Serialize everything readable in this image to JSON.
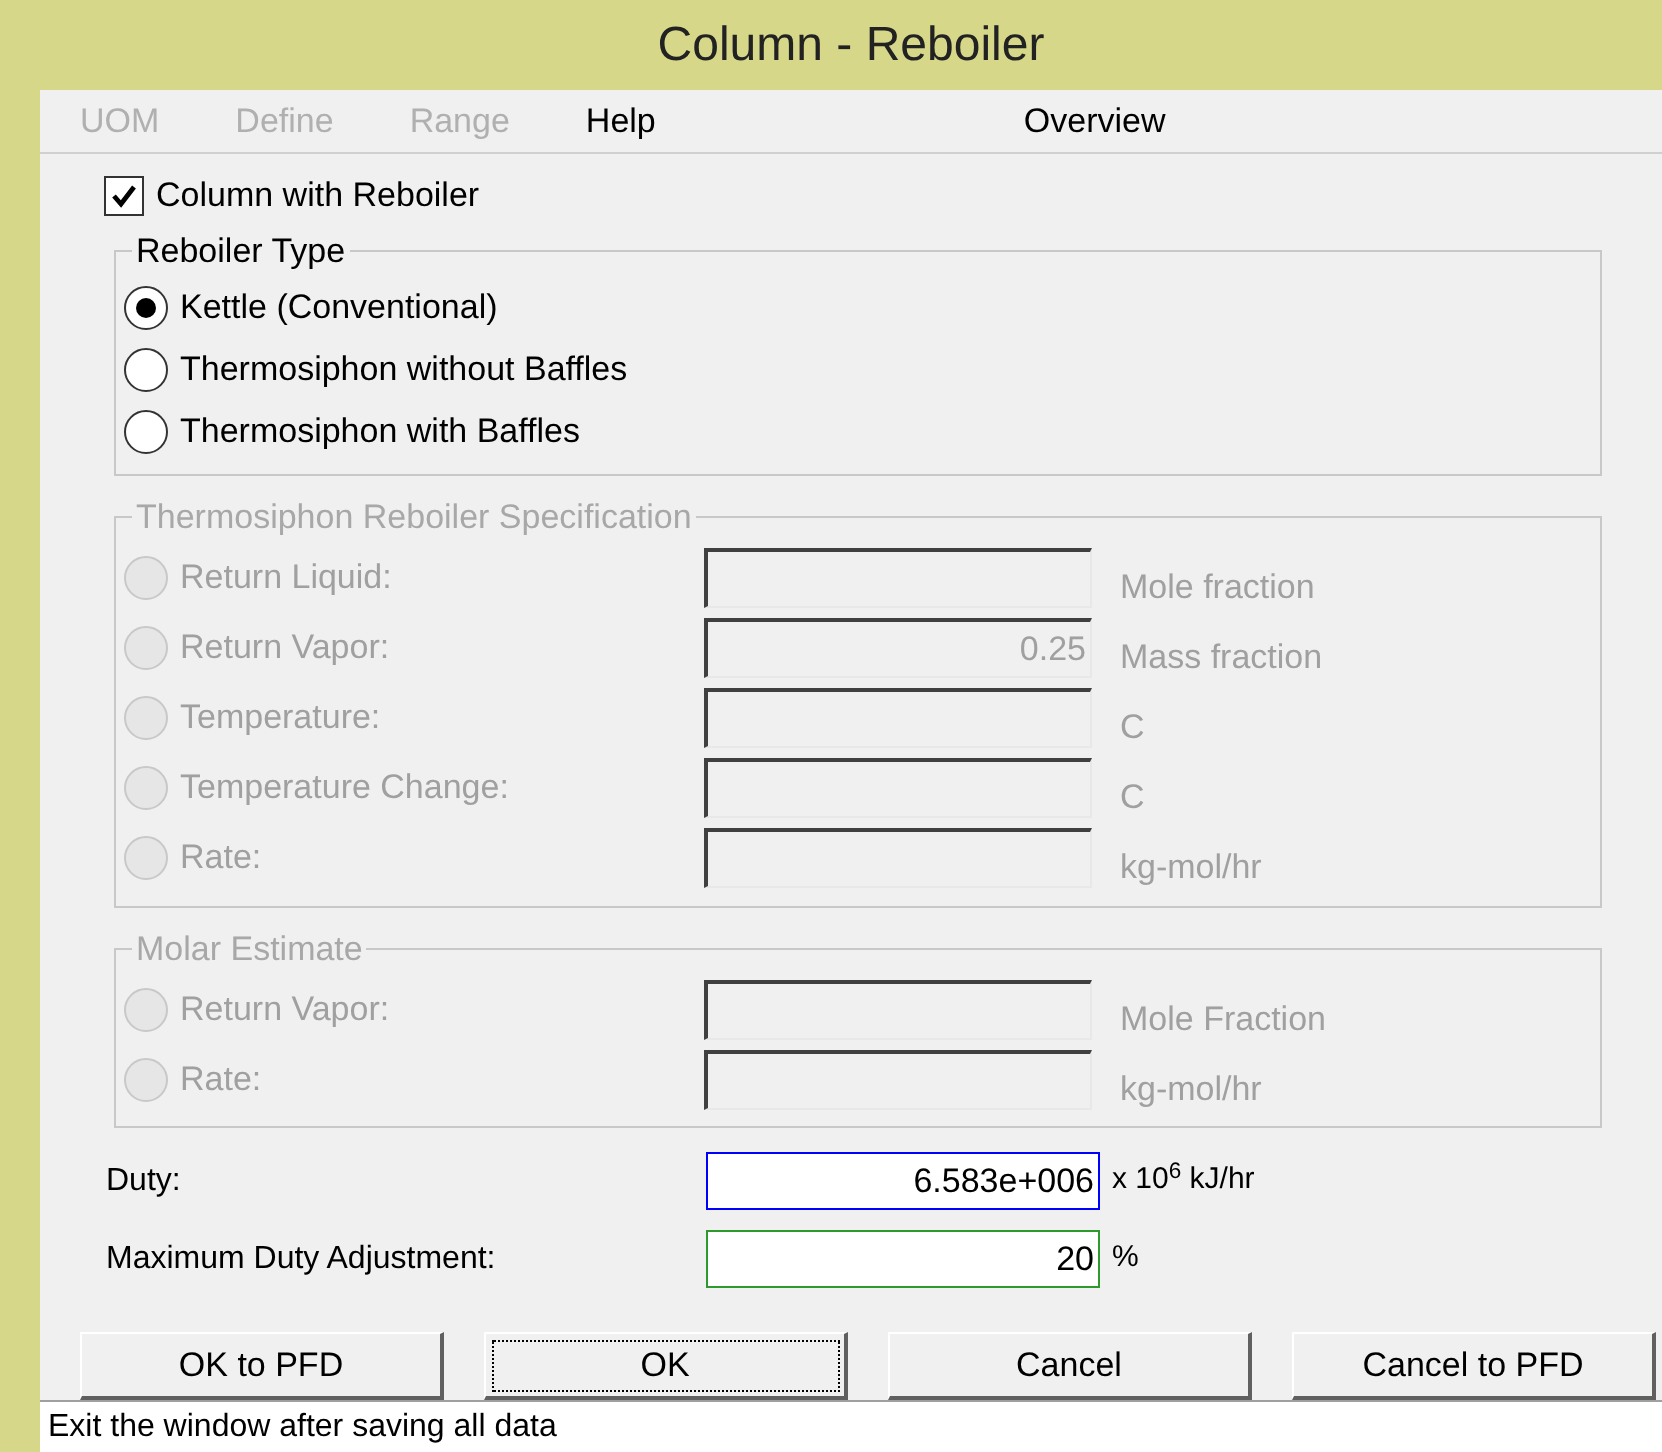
{
  "window": {
    "title": "Column - Reboiler"
  },
  "menu": [
    {
      "label": "UOM",
      "disabled": true
    },
    {
      "label": "Define",
      "disabled": true
    },
    {
      "label": "Range",
      "disabled": true
    },
    {
      "label": "Help",
      "disabled": false
    },
    {
      "label": "Overview",
      "disabled": false
    }
  ],
  "reboiler_checkbox": {
    "label": "Column with Reboiler",
    "checked": true
  },
  "groups": [
    {
      "title": "Reboiler Type",
      "disabled": false,
      "kind": "choice",
      "options": [
        {
          "label": "Kettle (Conventional)",
          "selected": true
        },
        {
          "label": "Thermosiphon without Baffles",
          "selected": false
        },
        {
          "label": "Thermosiphon with Baffles",
          "selected": false
        }
      ]
    },
    {
      "title": "Thermosiphon Reboiler Specification",
      "disabled": true,
      "kind": "spec",
      "options": [
        {
          "label": "Return Liquid:",
          "selected": false,
          "unit": "Mole fraction"
        },
        {
          "label": "Return Vapor:",
          "selected": false,
          "value": "0.25",
          "unit": "Mass fraction"
        },
        {
          "label": "Temperature:",
          "selected": false,
          "unit": "C"
        },
        {
          "label": "Temperature Change:",
          "selected": false,
          "unit": "C"
        },
        {
          "label": "Rate:",
          "selected": false,
          "unit": "kg-mol/hr"
        }
      ]
    },
    {
      "title": "Molar Estimate",
      "disabled": true,
      "kind": "spec",
      "options": [
        {
          "label": "Return Vapor:",
          "selected": false,
          "unit": "Mole Fraction"
        },
        {
          "label": "Rate:",
          "selected": false,
          "unit": "kg-mol/hr"
        }
      ]
    }
  ],
  "fields": [
    {
      "label": "Duty:",
      "value": "6.583e+006",
      "unit": "x 10$^{6}$ kJ/hr",
      "kind": "focused"
    },
    {
      "label": "Maximum Duty Adjustment:",
      "value": "20",
      "unit": "%",
      "kind": "specified"
    }
  ],
  "buttons": [
    {
      "label": "OK to PFD",
      "focused": false
    },
    {
      "label": "OK",
      "focused": true
    },
    {
      "label": "Cancel",
      "focused": false
    },
    {
      "label": "Cancel to PFD",
      "focused": false
    }
  ],
  "status_bar": "Exit the window after saving all data"
}
